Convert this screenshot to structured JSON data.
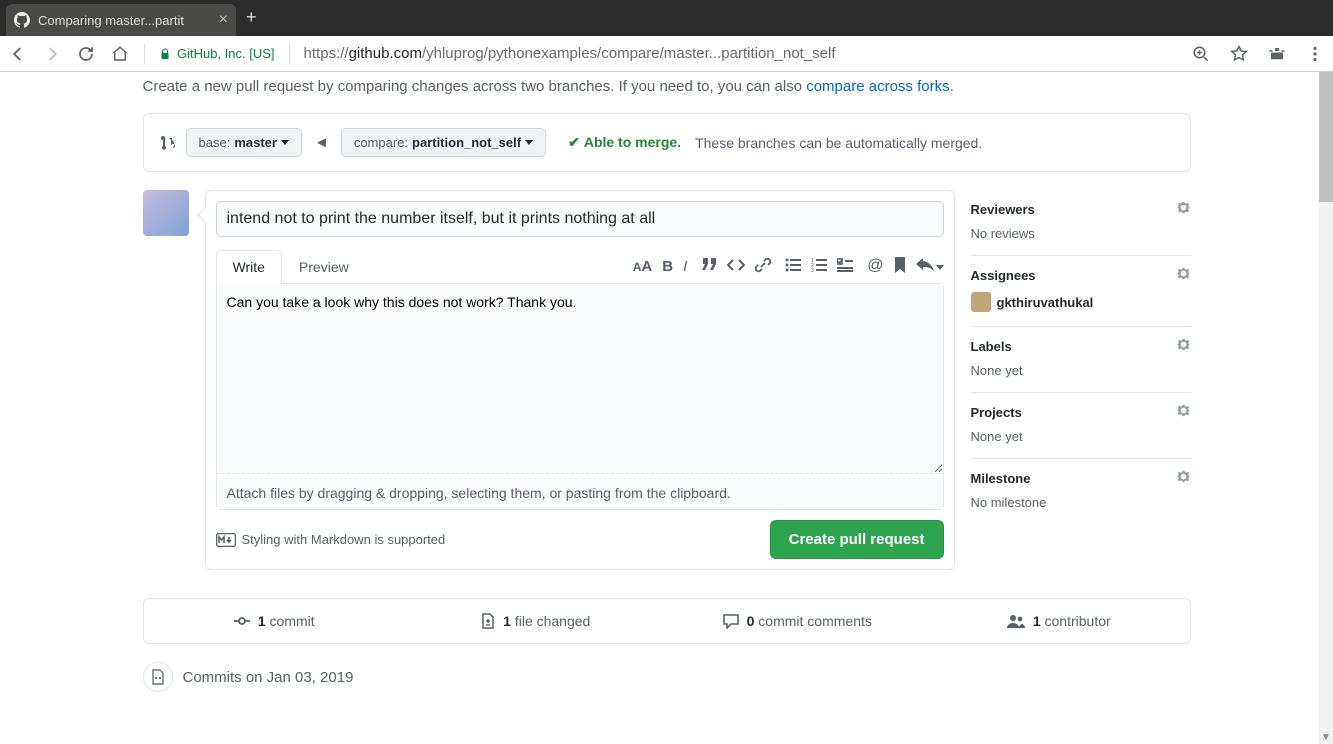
{
  "browser": {
    "tab_title": "Comparing master...partit",
    "secure_label": "GitHub, Inc. [US]",
    "url_prefix": "https://",
    "url_domain": "github.com",
    "url_path": "/yhluprog/pythonexamples/compare/master...partition_not_self"
  },
  "intro": {
    "text": "Create a new pull request by comparing changes across two branches. If you need to, you can also ",
    "link": "compare across forks",
    "period": "."
  },
  "compare": {
    "base_prefix": "base: ",
    "base_branch": "master",
    "compare_prefix": "compare: ",
    "compare_branch": "partition_not_self",
    "merge_ok": "Able to merge.",
    "merge_note": "These branches can be automatically merged."
  },
  "pr": {
    "title_value": "intend not to print the number itself, but it prints nothing at all",
    "tab_write": "Write",
    "tab_preview": "Preview",
    "body_value": "Can you take a look why this does not work? Thank you.",
    "attach_hint": "Attach files by dragging & dropping, selecting them, or pasting from the clipboard.",
    "md_support": "Styling with Markdown is supported",
    "submit": "Create pull request"
  },
  "sidebar": {
    "reviewers_title": "Reviewers",
    "reviewers_body": "No reviews",
    "assignees_title": "Assignees",
    "assignee_name": "gkthiruvathukal",
    "labels_title": "Labels",
    "labels_body": "None yet",
    "projects_title": "Projects",
    "projects_body": "None yet",
    "milestone_title": "Milestone",
    "milestone_body": "No milestone"
  },
  "stats": {
    "commits_n": "1",
    "commits_label": " commit",
    "files_n": "1",
    "files_label": " file changed",
    "comments_n": "0",
    "comments_label": " commit comments",
    "contrib_n": "1",
    "contrib_label": " contributor"
  },
  "timeline": {
    "commits_on": "Commits on Jan 03, 2019"
  }
}
